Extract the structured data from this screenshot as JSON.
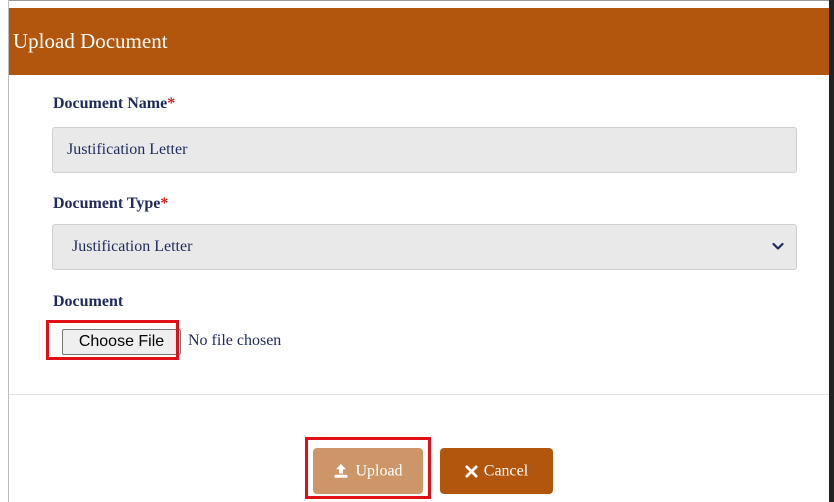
{
  "dialog": {
    "title": "Upload Document"
  },
  "form": {
    "doc_name": {
      "label": "Document Name",
      "required_mark": "*",
      "value": "Justification Letter"
    },
    "doc_type": {
      "label": "Document Type",
      "required_mark": "*",
      "selected": "Justification Letter"
    },
    "document": {
      "label": "Document",
      "choose_label": "Choose File",
      "status": "No file chosen"
    }
  },
  "footer": {
    "upload_label": "Upload",
    "cancel_label": "Cancel"
  },
  "colors": {
    "header_bg": "#b2550d",
    "label_text": "#1f2a5a",
    "required": "#cc1e1e",
    "upload_bg": "#cd9669",
    "cancel_bg": "#b2550d",
    "highlight": "#e10f18"
  },
  "icons": {
    "select_chevron": "chevron-down-icon",
    "upload": "upload-icon",
    "cancel": "close-icon"
  }
}
